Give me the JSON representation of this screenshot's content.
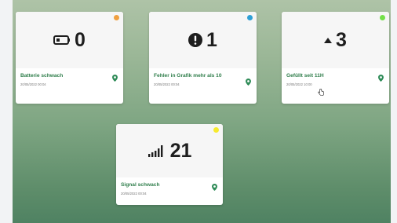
{
  "colors": {
    "orange": "#f0a040",
    "blue": "#2fa0d6",
    "green": "#74e04a",
    "yellow": "#f7ea2e",
    "pin": "#2e8b57"
  },
  "cards": [
    {
      "value": "0",
      "title": "Batterie schwach",
      "date": "20/05/2022 00:04",
      "icon": "battery-icon"
    },
    {
      "value": "1",
      "title": "Fehler in Grafik mehr als 10",
      "date": "20/05/2022 00:04",
      "icon": "alert-icon"
    },
    {
      "value": "3",
      "title": "Gefüllt seit 11H",
      "date": "20/05/2022 10:00",
      "icon": "caret-up-icon"
    },
    {
      "value": "21",
      "title": "Signal schwach",
      "date": "20/05/2022 00:04",
      "icon": "signal-icon"
    }
  ]
}
